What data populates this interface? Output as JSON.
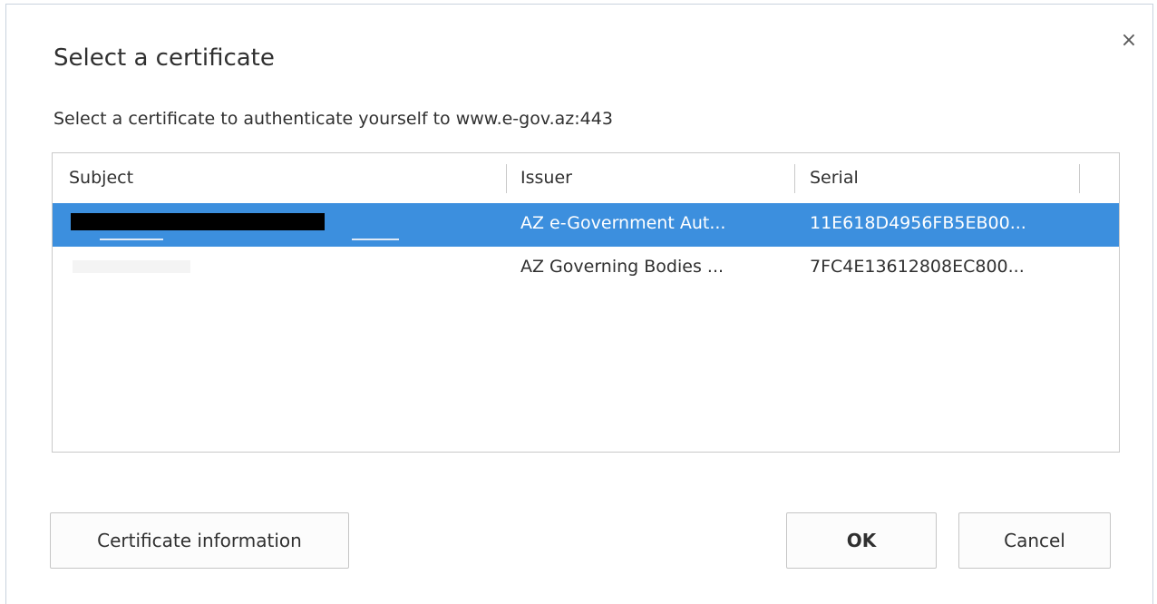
{
  "dialog": {
    "title": "Select a certificate",
    "subtitle": "Select a certificate to authenticate yourself to www.e-gov.az:443",
    "close_label": "×"
  },
  "table": {
    "columns": [
      "Subject",
      "Issuer",
      "Serial"
    ],
    "rows": [
      {
        "subject": "",
        "issuer": "AZ e-Government Aut...",
        "serial": "11E618D4956FB5EB00...",
        "selected": true
      },
      {
        "subject": "",
        "issuer": "AZ Governing Bodies ...",
        "serial": "7FC4E13612808EC800...",
        "selected": false
      }
    ]
  },
  "buttons": {
    "certificate_info": "Certificate information",
    "ok": "OK",
    "cancel": "Cancel"
  },
  "colors": {
    "selection": "#3c8fde",
    "text": "#303030",
    "border": "#c9c9c9"
  }
}
